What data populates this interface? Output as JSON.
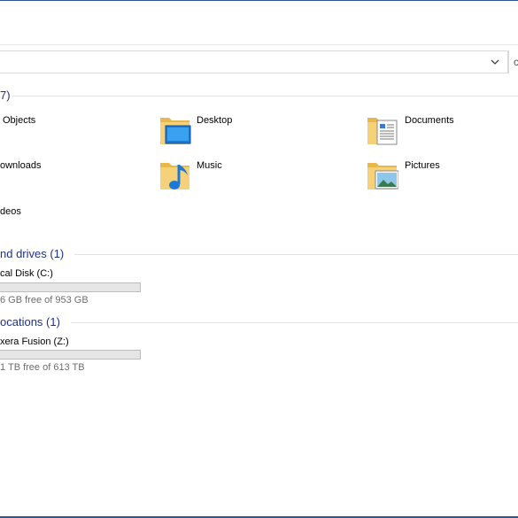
{
  "window": {
    "accent_color": "#2b5797"
  },
  "address_bar": {
    "dropdown_icon": "chevron-down-icon",
    "refresh_icon": "refresh-icon"
  },
  "folders_group": {
    "header": "7)",
    "items": [
      {
        "label": "Objects",
        "icon": "3d-objects-folder-icon"
      },
      {
        "label": "Desktop",
        "icon": "desktop-folder-icon"
      },
      {
        "label": "Documents",
        "icon": "documents-folder-icon"
      },
      {
        "label": "ownloads",
        "icon": "downloads-folder-icon"
      },
      {
        "label": "Music",
        "icon": "music-folder-icon"
      },
      {
        "label": "Pictures",
        "icon": "pictures-folder-icon"
      },
      {
        "label": "deos",
        "icon": "videos-folder-icon"
      }
    ]
  },
  "drives_group": {
    "header": "nd drives (1)",
    "drives": [
      {
        "name": "cal Disk (C:)",
        "free_text": "6 GB free of 953 GB",
        "used_fraction": 0.0
      }
    ]
  },
  "network_group": {
    "header": "ocations (1)",
    "drives": [
      {
        "name": "xera Fusion (Z:)",
        "free_text": "1 TB free of 613 TB",
        "used_fraction": 0.0
      }
    ]
  }
}
